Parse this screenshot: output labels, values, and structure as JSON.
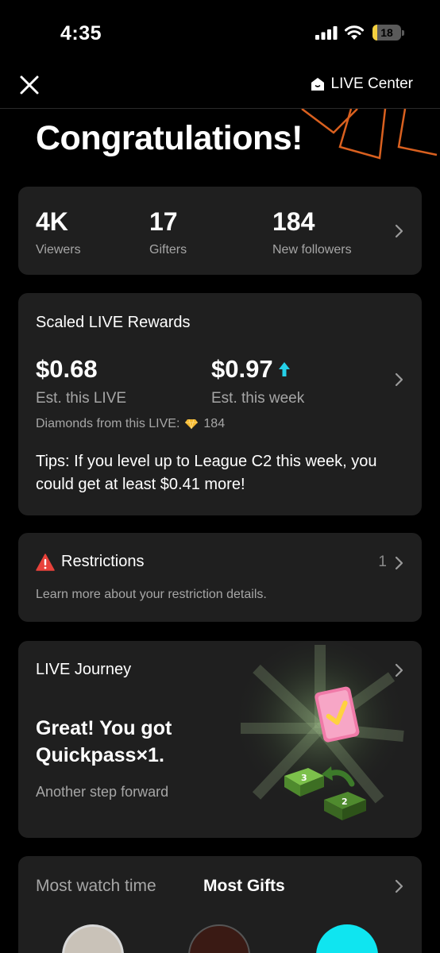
{
  "status_bar": {
    "time": "4:35",
    "battery": "18",
    "battery_level": 0.18
  },
  "header": {
    "live_center_label": "LIVE Center"
  },
  "congrats": "Congratulations!",
  "stats": [
    {
      "value": "4K",
      "label": "Viewers"
    },
    {
      "value": "17",
      "label": "Gifters"
    },
    {
      "value": "184",
      "label": "New followers"
    }
  ],
  "rewards": {
    "title": "Scaled LIVE Rewards",
    "live_amount": "$0.68",
    "live_label": "Est. this LIVE",
    "week_amount": "$0.97",
    "week_label": "Est. this week",
    "diamonds_label": "Diamonds from this LIVE:",
    "diamonds_value": "184",
    "tips": "Tips: If you level up to League C2 this week, you could get at least $0.41 more!"
  },
  "restrictions": {
    "title": "Restrictions",
    "count": "1",
    "description": "Learn more about your restriction details."
  },
  "journey": {
    "title": "LIVE Journey",
    "headline": "Great! You got Quickpass×1.",
    "subtitle": "Another step forward"
  },
  "gifts": {
    "tab_watch": "Most watch time",
    "tab_gifts": "Most Gifts"
  },
  "colors": {
    "background": "#000000",
    "card": "#1f1f1f",
    "accent_arrow": "#25d0e8",
    "warning": "#e8423b",
    "decor_orange": "#d9601f"
  },
  "icons": [
    "signal-icon",
    "wifi-icon",
    "close-icon",
    "home-icon",
    "chevron-right-icon",
    "arrow-up-icon",
    "diamond-icon",
    "warning-icon"
  ]
}
